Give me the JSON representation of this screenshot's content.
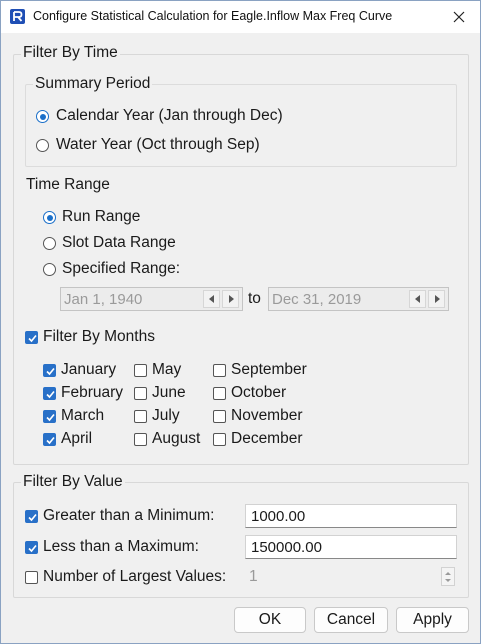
{
  "window": {
    "title": "Configure Statistical Calculation for Eagle.Inflow Max Freq Curve"
  },
  "filter_by_time": {
    "title": "Filter By Time",
    "summary_period": {
      "title": "Summary Period",
      "options": [
        {
          "label": "Calendar Year (Jan through Dec)",
          "selected": true
        },
        {
          "label": "Water Year (Oct through Sep)",
          "selected": false
        }
      ]
    },
    "time_range": {
      "title": "Time Range",
      "options": [
        {
          "label": "Run Range",
          "selected": true
        },
        {
          "label": "Slot Data Range",
          "selected": false
        },
        {
          "label": "Specified Range:",
          "selected": false
        }
      ],
      "start_date": "Jan 1, 1940",
      "to_label": "to",
      "end_date": "Dec 31, 2019"
    },
    "filter_by_months": {
      "label": "Filter By Months",
      "checked": true,
      "months": [
        {
          "label": "January",
          "checked": true
        },
        {
          "label": "February",
          "checked": true
        },
        {
          "label": "March",
          "checked": true
        },
        {
          "label": "April",
          "checked": true
        },
        {
          "label": "May",
          "checked": false
        },
        {
          "label": "June",
          "checked": false
        },
        {
          "label": "July",
          "checked": false
        },
        {
          "label": "August",
          "checked": false
        },
        {
          "label": "September",
          "checked": false
        },
        {
          "label": "October",
          "checked": false
        },
        {
          "label": "November",
          "checked": false
        },
        {
          "label": "December",
          "checked": false
        }
      ]
    }
  },
  "filter_by_value": {
    "title": "Filter By Value",
    "greater_than_min": {
      "label": "Greater than a Minimum:",
      "checked": true,
      "value": "1000.00"
    },
    "less_than_max": {
      "label": "Less than a Maximum:",
      "checked": true,
      "value": "150000.00"
    },
    "largest_values": {
      "label": "Number of Largest Values:",
      "checked": false,
      "value": "1"
    }
  },
  "buttons": {
    "ok": "OK",
    "cancel": "Cancel",
    "apply": "Apply"
  },
  "colors": {
    "accent": "#2870c8",
    "window_bg": "#f0f0f0",
    "disabled_text": "#9a9a9a"
  }
}
